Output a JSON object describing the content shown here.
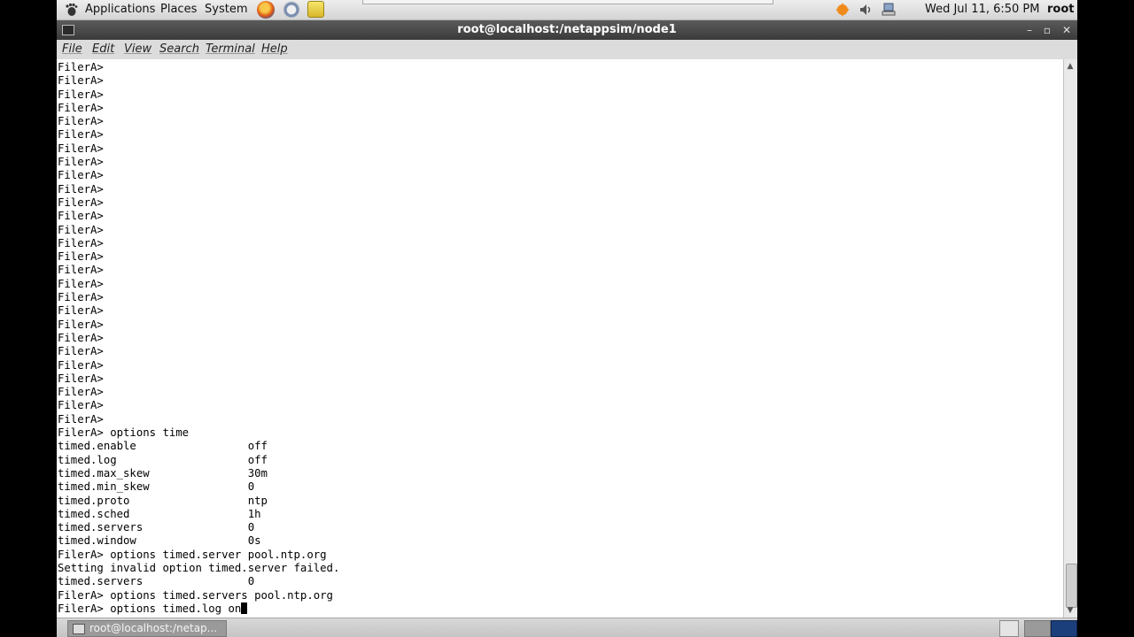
{
  "top_panel": {
    "menus": [
      "Applications",
      "Places",
      "System"
    ],
    "clock": "Wed Jul 11,  6:50 PM",
    "user": "root"
  },
  "window": {
    "title": "root@localhost:/netappsim/node1",
    "buttons": {
      "minimize": "–",
      "maximize": "▫",
      "close": "✕"
    }
  },
  "menubar": [
    "File",
    "Edit",
    "View",
    "Search",
    "Terminal",
    "Help"
  ],
  "terminal": {
    "lines": [
      "FilerA>",
      "FilerA>",
      "FilerA>",
      "FilerA>",
      "FilerA>",
      "FilerA>",
      "FilerA>",
      "FilerA>",
      "FilerA>",
      "FilerA>",
      "FilerA>",
      "FilerA>",
      "FilerA>",
      "FilerA>",
      "FilerA>",
      "FilerA>",
      "FilerA>",
      "FilerA>",
      "FilerA>",
      "FilerA>",
      "FilerA>",
      "FilerA>",
      "FilerA>",
      "FilerA>",
      "FilerA>",
      "FilerA>",
      "FilerA>",
      "FilerA> options time",
      "timed.enable                 off",
      "timed.log                    off",
      "timed.max_skew               30m",
      "timed.min_skew               0",
      "timed.proto                  ntp",
      "timed.sched                  1h",
      "timed.servers                0",
      "timed.window                 0s",
      "FilerA> options timed.server pool.ntp.org",
      "Setting invalid option timed.server failed.",
      "timed.servers                0",
      "FilerA> options timed.servers pool.ntp.org",
      "FilerA> options timed.log on"
    ]
  },
  "bottom_panel": {
    "task": "root@localhost:/netap..."
  },
  "icons": {
    "app_menu": "gnome-foot-icon",
    "launchers": [
      "firefox-icon",
      "mail-icon",
      "notes-icon"
    ],
    "tray": [
      "update-icon",
      "volume-icon",
      "network-icon"
    ]
  }
}
